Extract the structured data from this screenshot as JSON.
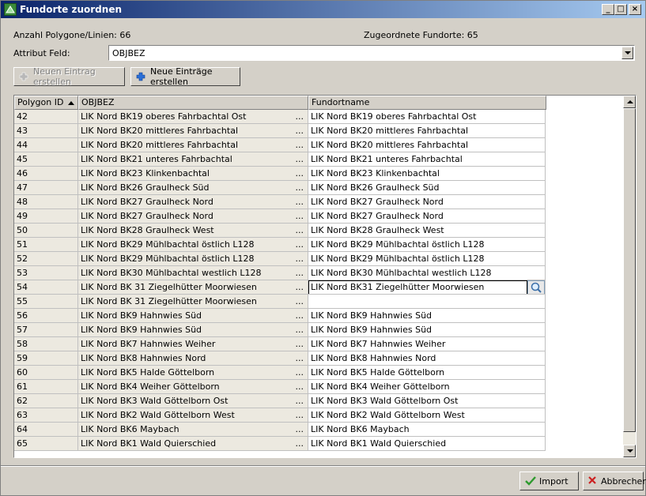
{
  "window": {
    "title": "Fundorte zuordnen",
    "icon": "app-icon"
  },
  "titlebar_buttons": {
    "minimize": "_",
    "maximize": "□",
    "close": "×"
  },
  "info": {
    "polygon_count_text": "Anzahl Polygone/Linien: 66",
    "assigned_count_text": "Zugeordnete Fundorte: 65"
  },
  "attribute_field": {
    "label": "Attribut Feld:",
    "value": "OBJBEZ"
  },
  "toolbar": {
    "new_entry_label": "Neuen Eintrag erstellen",
    "new_entries_label": "Neue Einträge erstellen"
  },
  "table": {
    "columns": [
      "Polygon ID",
      "OBJBEZ",
      "Fundortname"
    ],
    "sorted_column": "Polygon ID",
    "rows": [
      {
        "id": "42",
        "objbez": "LIK Nord BK19 oberes Fahrbachtal Ost",
        "fundort": "LIK Nord BK19 oberes Fahrbachtal Ost"
      },
      {
        "id": "43",
        "objbez": "LIK Nord BK20 mittleres Fahrbachtal",
        "fundort": "LIK Nord BK20 mittleres Fahrbachtal"
      },
      {
        "id": "44",
        "objbez": "LIK Nord BK20 mittleres Fahrbachtal",
        "fundort": "LIK Nord BK20 mittleres Fahrbachtal"
      },
      {
        "id": "45",
        "objbez": "LIK Nord BK21 unteres Fahrbachtal",
        "fundort": "LIK Nord BK21 unteres Fahrbachtal"
      },
      {
        "id": "46",
        "objbez": "LIK Nord BK23 Klinkenbachtal",
        "fundort": "LIK Nord BK23 Klinkenbachtal"
      },
      {
        "id": "47",
        "objbez": "LIK Nord BK26 Graulheck Süd",
        "fundort": "LIK Nord BK26 Graulheck Süd"
      },
      {
        "id": "48",
        "objbez": "LIK Nord BK27 Graulheck Nord",
        "fundort": "LIK Nord BK27 Graulheck Nord"
      },
      {
        "id": "49",
        "objbez": "LIK Nord BK27 Graulheck Nord",
        "fundort": "LIK Nord BK27 Graulheck Nord"
      },
      {
        "id": "50",
        "objbez": "LIK Nord BK28 Graulheck West",
        "fundort": "LIK Nord BK28 Graulheck West"
      },
      {
        "id": "51",
        "objbez": "LIK Nord BK29 Mühlbachtal östlich L128",
        "fundort": "LIK Nord BK29 Mühlbachtal östlich L128"
      },
      {
        "id": "52",
        "objbez": "LIK Nord BK29 Mühlbachtal östlich L128",
        "fundort": "LIK Nord BK29 Mühlbachtal östlich L128"
      },
      {
        "id": "53",
        "objbez": "LIK Nord BK30 Mühlbachtal westlich L128",
        "fundort": "LIK Nord BK30 Mühlbachtal westlich L128"
      },
      {
        "id": "54",
        "objbez": "LIK Nord BK 31 Ziegelhütter Moorwiesen",
        "fundort": "LIK Nord BK31 Ziegelhütter Moorwiesen",
        "editing": true
      },
      {
        "id": "55",
        "objbez": "LIK Nord BK 31 Ziegelhütter Moorwiesen",
        "fundort": ""
      },
      {
        "id": "56",
        "objbez": "LIK Nord BK9 Hahnwies Süd",
        "fundort": "LIK Nord BK9 Hahnwies Süd"
      },
      {
        "id": "57",
        "objbez": "LIK Nord BK9 Hahnwies Süd",
        "fundort": "LIK Nord BK9 Hahnwies Süd"
      },
      {
        "id": "58",
        "objbez": "LIK Nord BK7 Hahnwies Weiher",
        "fundort": "LIK Nord BK7 Hahnwies Weiher"
      },
      {
        "id": "59",
        "objbez": "LIK Nord BK8 Hahnwies Nord",
        "fundort": "LIK Nord BK8 Hahnwies Nord"
      },
      {
        "id": "60",
        "objbez": "LIK Nord BK5 Halde Göttelborn",
        "fundort": "LIK Nord BK5 Halde Göttelborn"
      },
      {
        "id": "61",
        "objbez": "LIK Nord BK4 Weiher Göttelborn",
        "fundort": "LIK Nord BK4 Weiher Göttelborn"
      },
      {
        "id": "62",
        "objbez": "LIK Nord BK3 Wald Göttelborn Ost",
        "fundort": "LIK Nord BK3 Wald Göttelborn Ost"
      },
      {
        "id": "63",
        "objbez": "LIK Nord BK2 Wald Göttelborn West",
        "fundort": "LIK Nord BK2 Wald Göttelborn West"
      },
      {
        "id": "64",
        "objbez": "LIK Nord BK6 Maybach",
        "fundort": "LIK Nord BK6 Maybach"
      },
      {
        "id": "65",
        "objbez": "LIK Nord BK1 Wald Quierschied",
        "fundort": "LIK Nord BK1 Wald Quierschied"
      }
    ],
    "ellipsis": "..."
  },
  "footer": {
    "import_label": "Import",
    "cancel_label": "Abbrechen"
  },
  "colors": {
    "titlebar_start": "#0a246a",
    "titlebar_end": "#a6caf0",
    "import_check": "#2e9a2e",
    "cancel_x": "#cc2020",
    "plus_blue": "#2a6fd8"
  }
}
